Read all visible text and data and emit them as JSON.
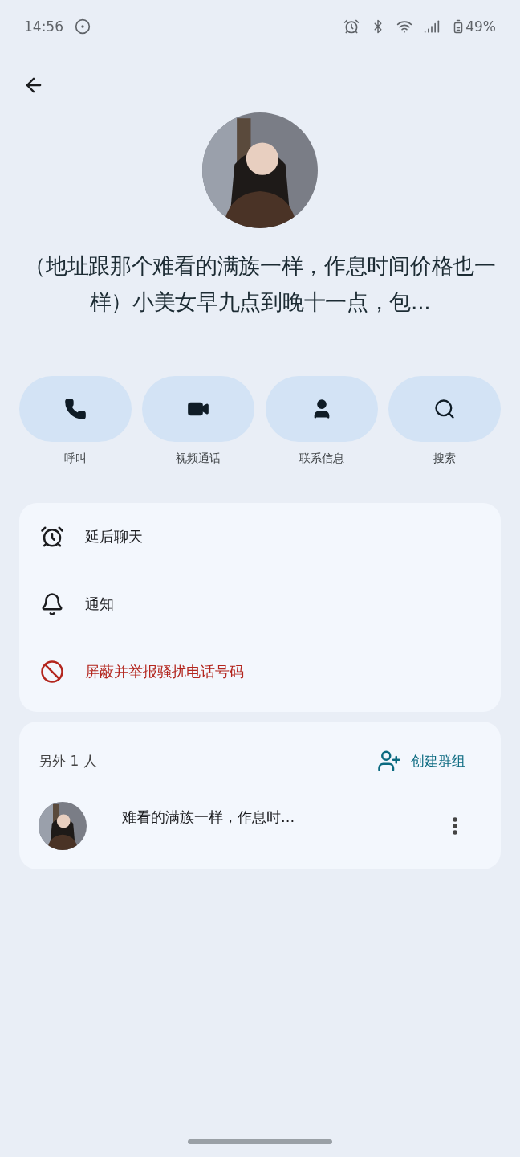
{
  "status_bar": {
    "time": "14:56",
    "battery": "49%"
  },
  "contact": {
    "name": "（地址跟那个难看的满族一样，作息时间价格也一样）小美女早九点到晚十一点，包..."
  },
  "actions": [
    {
      "kind": "call",
      "label": "呼叫"
    },
    {
      "kind": "video",
      "label": "视频通话"
    },
    {
      "kind": "contact",
      "label": "联系信息"
    },
    {
      "kind": "search",
      "label": "搜索"
    }
  ],
  "options": [
    {
      "kind": "snooze",
      "label": "延后聊天",
      "danger": false
    },
    {
      "kind": "notify",
      "label": "通知",
      "danger": false
    },
    {
      "kind": "block",
      "label": "屏蔽并举报骚扰电话号码",
      "danger": true
    }
  ],
  "participants": {
    "heading": "另外 1 人",
    "create_group": "创建群组",
    "people": [
      {
        "name": "难看的满族一样，作息时..."
      }
    ]
  }
}
